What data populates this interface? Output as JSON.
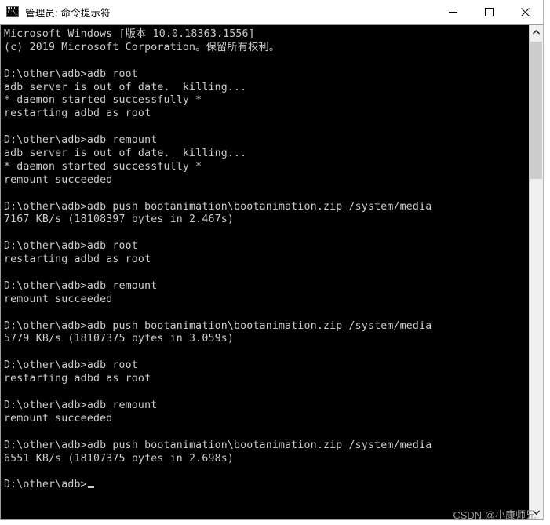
{
  "window": {
    "title": "管理员: 命令提示符",
    "icon": "cmd-console-icon",
    "icon_prompt_text": "C:\\_",
    "controls": [
      {
        "name": "minimize",
        "label": "—"
      },
      {
        "name": "maximize",
        "label": "□"
      },
      {
        "name": "close",
        "label": "✕"
      }
    ]
  },
  "console": {
    "background_color": "#000000",
    "text_color": "#cccccc",
    "lines": [
      "Microsoft Windows [版本 10.0.18363.1556]",
      "(c) 2019 Microsoft Corporation。保留所有权利。",
      "",
      "D:\\other\\adb>adb root",
      "adb server is out of date.  killing...",
      "* daemon started successfully *",
      "restarting adbd as root",
      "",
      "D:\\other\\adb>adb remount",
      "adb server is out of date.  killing...",
      "* daemon started successfully *",
      "remount succeeded",
      "",
      "D:\\other\\adb>adb push bootanimation\\bootanimation.zip /system/media",
      "7167 KB/s (18108397 bytes in 2.467s)",
      "",
      "D:\\other\\adb>adb root",
      "restarting adbd as root",
      "",
      "D:\\other\\adb>adb remount",
      "remount succeeded",
      "",
      "D:\\other\\adb>adb push bootanimation\\bootanimation.zip /system/media",
      "5779 KB/s (18107375 bytes in 3.059s)",
      "",
      "D:\\other\\adb>adb root",
      "restarting adbd as root",
      "",
      "D:\\other\\adb>adb remount",
      "remount succeeded",
      "",
      "D:\\other\\adb>adb push bootanimation\\bootanimation.zip /system/media",
      "6551 KB/s (18107375 bytes in 2.698s)",
      "",
      "D:\\other\\adb>"
    ],
    "prompt_line_index": 34
  },
  "scrollbar": {
    "up_arrow": "▲",
    "down_arrow": "▼",
    "thumb_color": "#cdcdcd",
    "track_color": "#f0f0f0"
  },
  "watermark": {
    "text": "CSDN @小康师兄"
  }
}
